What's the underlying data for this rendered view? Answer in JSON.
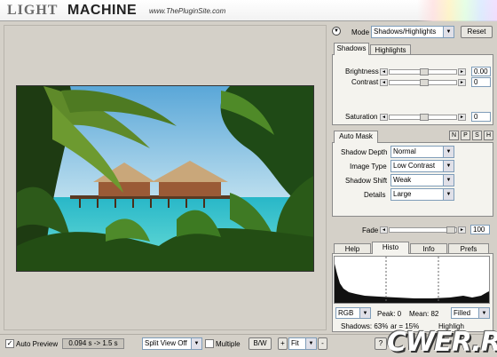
{
  "header": {
    "logo_light": "LIGHT",
    "logo_machine": "MACHINE",
    "site": "www.ThePluginSite.com"
  },
  "mode": {
    "label": "Mode",
    "value": "Shadows/Highlights",
    "reset_label": "Reset"
  },
  "tone_tabs": [
    "Shadows",
    "Highlights"
  ],
  "sliders": {
    "brightness": {
      "label": "Brightness",
      "value": "0.00"
    },
    "contrast": {
      "label": "Contrast",
      "value": "0"
    },
    "saturation": {
      "label": "Saturation",
      "value": "0"
    }
  },
  "automask": {
    "tab_label": "Auto Mask",
    "buttons": [
      "N",
      "P",
      "S",
      "H"
    ],
    "shadow_depth": {
      "label": "Shadow Depth",
      "value": "Normal"
    },
    "image_type": {
      "label": "Image Type",
      "value": "Low Contrast"
    },
    "shadow_shift": {
      "label": "Shadow Shift",
      "value": "Weak"
    },
    "details": {
      "label": "Details",
      "value": "Large"
    }
  },
  "fade": {
    "label": "Fade",
    "value": "100"
  },
  "bottom_tabs": [
    "Help",
    "Histo",
    "Info",
    "Prefs"
  ],
  "histogram": {
    "channel": "RGB",
    "peak": "Peak: 0",
    "mean": "Mean: 82",
    "style": "Filled",
    "shadows": "Shadows: 63%",
    "mid": "ar = 15%",
    "highlight": "Highligh"
  },
  "bottombar": {
    "auto_preview": "Auto Preview",
    "ratio": "0.094 s -> 1.5 s",
    "split_view": "Split View Off",
    "multiple": "Multiple",
    "bw": "B/W",
    "plus": "+",
    "zoom": "Fit",
    "minus": "-",
    "help": "?"
  },
  "watermark": "CWER.RU",
  "colors": {
    "panel_bg": "#d4d0c8",
    "accent": "#7f9db9"
  }
}
